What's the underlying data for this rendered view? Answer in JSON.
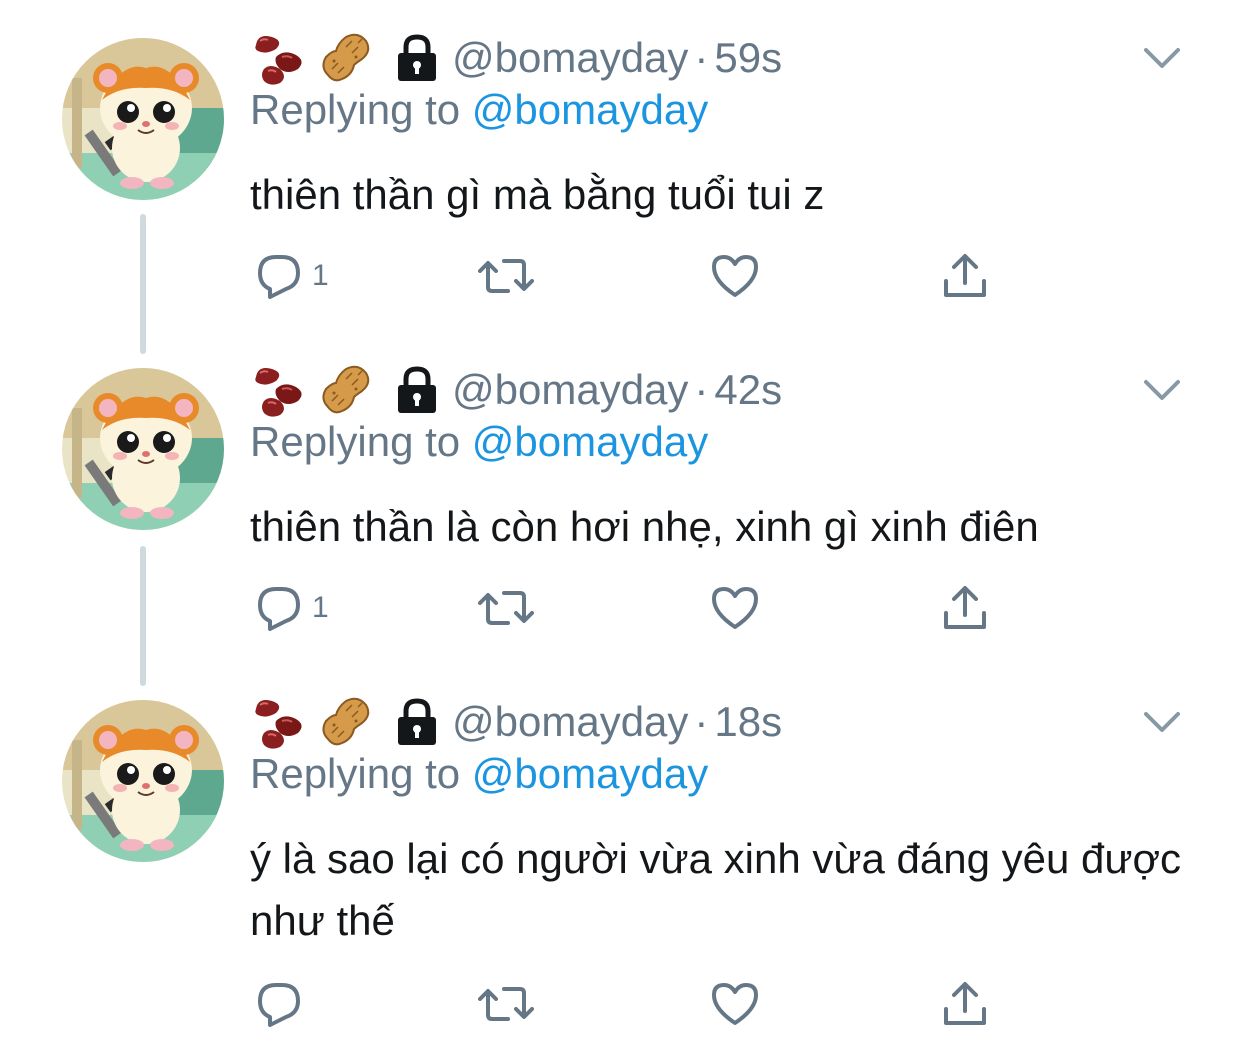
{
  "tweets": [
    {
      "emojis": [
        "beans-emoji",
        "peanut-emoji"
      ],
      "handle": "@bomayday",
      "separator": "·",
      "time": "59s",
      "replying_prefix": "Replying to",
      "replying_to": "@bomayday",
      "text": "thiên thần gì mà bằng tuổi tui z",
      "reply_count": "1"
    },
    {
      "emojis": [
        "beans-emoji",
        "peanut-emoji"
      ],
      "handle": "@bomayday",
      "separator": "·",
      "time": "42s",
      "replying_prefix": "Replying to",
      "replying_to": "@bomayday",
      "text": "thiên thần là còn hơi nhẹ, xinh gì xinh điên",
      "reply_count": "1"
    },
    {
      "emojis": [
        "beans-emoji",
        "peanut-emoji"
      ],
      "handle": "@bomayday",
      "separator": "·",
      "time": "18s",
      "replying_prefix": "Replying to",
      "replying_to": "@bomayday",
      "text": "ý là sao lại có người vừa xinh vừa đáng yêu được như thế",
      "reply_count": ""
    }
  ],
  "icons": {
    "reply": "reply-icon",
    "retweet": "retweet-icon",
    "like": "heart-icon",
    "share": "share-icon",
    "caret": "chevron-down-icon",
    "lock": "lock-icon"
  },
  "colors": {
    "text": "#14171a",
    "secondary": "#657786",
    "link": "#1b95e0",
    "thread_line": "#cfd9de"
  }
}
